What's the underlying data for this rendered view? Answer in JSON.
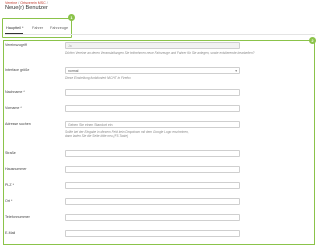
{
  "breadcrumb": {
    "item1": "Vereine",
    "item2": "Ortsverein MSC",
    "trailing_sep": "/"
  },
  "page_title": "Neue(r) Benutzer",
  "tabs": [
    {
      "label": "Hauptteil *",
      "active": true
    },
    {
      "label": "Fahrer",
      "active": false
    },
    {
      "label": "Fahrzeuge",
      "active": false
    }
  ],
  "badges": {
    "tabs": "1",
    "form": "2"
  },
  "form": {
    "vereinszugriff": {
      "label": "Vereinszugriff",
      "value": "Ja",
      "help": "Dürfen Vereine an deren Veranstaltungen Sie teilnehmen neue Fahrzeuge und Fahrer für Sie anlegen, sowie existierende bearbeiten?"
    },
    "interface": {
      "label": "Interface größe",
      "value": "normal",
      "help": "Diese Einstellung funktioniert NICHT in Firefox"
    },
    "nachname": {
      "label": "Nachname *",
      "value": ""
    },
    "vorname": {
      "label": "Vorname *",
      "value": ""
    },
    "adresse": {
      "label": "Adresse suchen",
      "placeholder": "Geben Sie einen Standort ein",
      "help1": "Sollte bei der Eingabe in diesem Feld kein Dropdown mit dem Google Logo erscheinen,",
      "help2": "dann laden Sie die Seite bitte neu (F5-Taste)"
    },
    "strasse": {
      "label": "Straße",
      "value": ""
    },
    "hausnummer": {
      "label": "Hausnummer",
      "value": ""
    },
    "plz": {
      "label": "PLZ *",
      "value": ""
    },
    "ort": {
      "label": "Ort *",
      "value": ""
    },
    "telefon": {
      "label": "Telefonnummer",
      "value": ""
    },
    "email": {
      "label": "E-Mail",
      "value": ""
    }
  },
  "colors": {
    "accent_green": "#8bc34a",
    "breadcrumb_red": "#c0392b"
  }
}
